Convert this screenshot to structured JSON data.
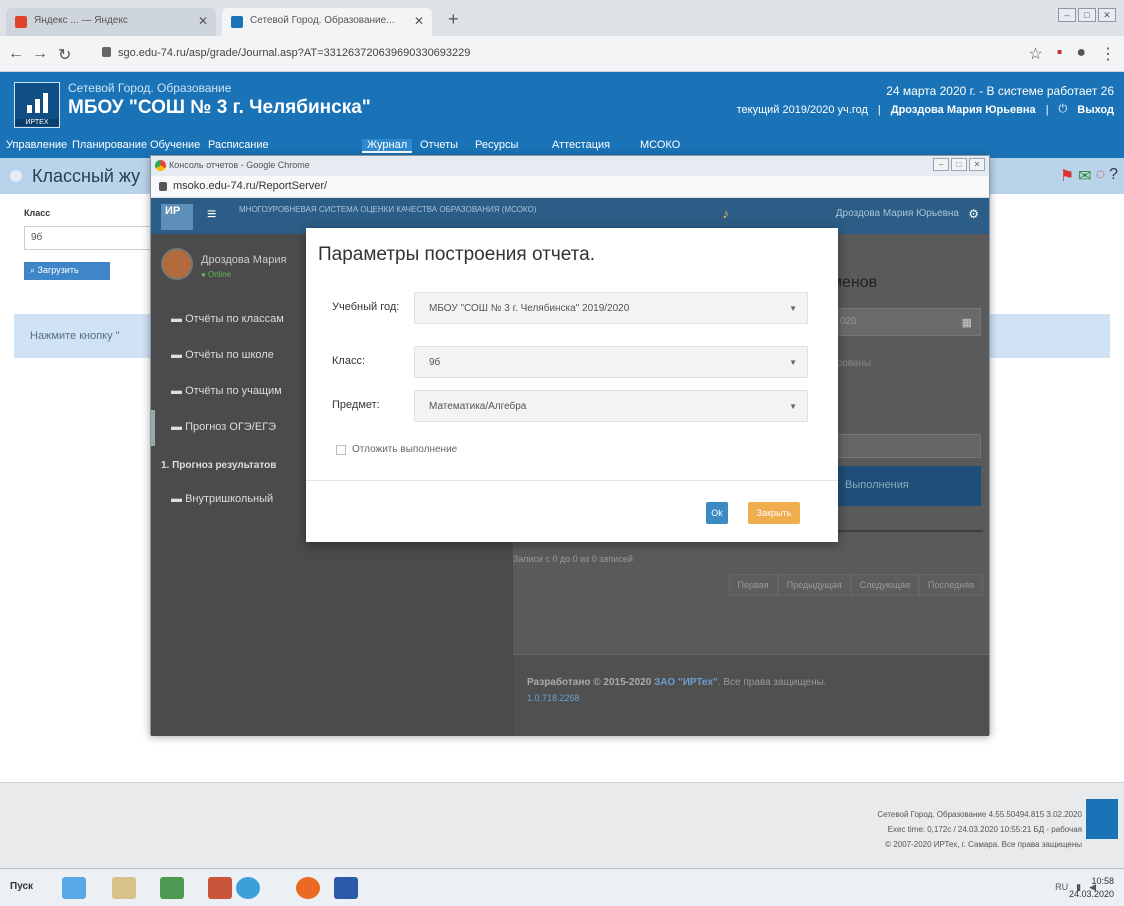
{
  "browser": {
    "tabs": [
      {
        "title": "Яндекс ... — Яндекс"
      },
      {
        "title": "Сетевой Город. Образование..."
      }
    ],
    "new_tab": "+",
    "url": "sgo.edu-74.ru/asp/grade/Journal.asp?AT=331263720639690330693229"
  },
  "site": {
    "system_name": "Сетевой Город. Образование",
    "school_name": "МБОУ \"СОШ № 3 г. Челябинска\"",
    "date_line": "24 марта 2020 г. - В системе работает 26",
    "year": "текущий 2019/2020 уч.год",
    "user": "Дроздова Мария Юрьевна",
    "logout": "Выход",
    "logo_text": "ИРТЕХ",
    "menu": [
      {
        "label": "Управление"
      },
      {
        "label": "Планирование"
      },
      {
        "label": "Обучение"
      },
      {
        "label": "Расписание"
      },
      {
        "label": "Журнал"
      },
      {
        "label": "Отчеты"
      },
      {
        "label": "Ресурсы"
      },
      {
        "label": "Аттестация"
      },
      {
        "label": "МСОКО"
      }
    ],
    "page_title": "Классный жу",
    "form": {
      "class_label": "Класс",
      "class_value": "9б",
      "load_button": "Загрузить"
    },
    "hint": "Нажмите кнопку \"",
    "footer": {
      "line1": "Сетевой Город. Образование 4.55.50494.815 3.02.2020",
      "line2": "Exec time: 0,172c / 24.03.2020 10:55:21 БД - рабочая",
      "line3": "© 2007-2020 ИРТех, г. Самара. Все права защищены"
    }
  },
  "popup": {
    "window_title": "Консоль отчетов - Google Chrome",
    "url": "msoko.edu-74.ru/ReportServer/",
    "app_logo": "ИР",
    "app_subtitle": "МНОГОУРОВНЕВАЯ СИСТЕМА ОЦЕНКИ КАЧЕСТВА ОБРАЗОВАНИЯ (МСОКО)",
    "user": "Дроздова Мария Юрьевна",
    "side_user": "Дроздова Мария",
    "side_status": "● Online",
    "side_items": [
      {
        "label": "Отчёты по классам"
      },
      {
        "label": "Отчёты по школе"
      },
      {
        "label": "Отчёты по учащим"
      },
      {
        "label": "Прогноз ОГЭ/ЕГЭ"
      },
      {
        "label": "Внутришкольный"
      }
    ],
    "side_sub": "1. Прогноз результатов",
    "main_heading": "менов",
    "main_field_value": "020",
    "main_check": "ированы",
    "main_run": "Выполнения",
    "records": "Записи с 0 до 0 из 0 записей",
    "pager": [
      "Первая",
      "Предыдущая",
      "Следующая",
      "Последняя"
    ],
    "footer_dev": "Разработано © 2015-2020",
    "footer_company": "ЗАО \"ИРТех\"",
    "footer_rights": ". Все права защищены.",
    "version": "1.0.718.2268"
  },
  "modal": {
    "title": "Параметры построения отчета.",
    "fields": [
      {
        "label": "Учебный год:",
        "value": "МБОУ \"СОШ № 3 г. Челябинска\" 2019/2020"
      },
      {
        "label": "Класс:",
        "value": "9б"
      },
      {
        "label": "Предмет:",
        "value": "Математика/Алгебра"
      }
    ],
    "defer_label": "Отложить выполнение",
    "ok": "Ok",
    "close": "Закрыть"
  },
  "taskbar": {
    "start": "Пуск",
    "lang": "RU",
    "time": "10:58",
    "date": "24.03.2020"
  },
  "colors": {
    "brand": "#1a73b6",
    "ok": "#3b8ac4",
    "close": "#f0ad4e"
  }
}
